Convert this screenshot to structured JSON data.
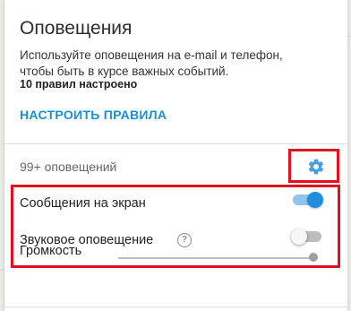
{
  "panel": {
    "title": "Оповещения",
    "description": "Используйте оповещения на e-mail и телефон, чтобы быть в курсе важных событий.",
    "rules_count": "10 правил настроено",
    "configure_link": "НАСТРОИТЬ ПРАВИЛА"
  },
  "notifications": {
    "count_label": "99+ оповещений",
    "settings_icon": "gear-icon"
  },
  "settings": {
    "screen_messages": {
      "label": "Сообщения на экран",
      "enabled": true
    },
    "sound_alert": {
      "label": "Звуковое оповещение",
      "enabled": false,
      "help_icon": "help-icon",
      "help_glyph": "?"
    },
    "volume": {
      "label": "Громкость",
      "value": 1.0
    }
  },
  "colors": {
    "accent": "#1f8fdd",
    "link": "#1a8fd8",
    "highlight": "#e3101f"
  }
}
